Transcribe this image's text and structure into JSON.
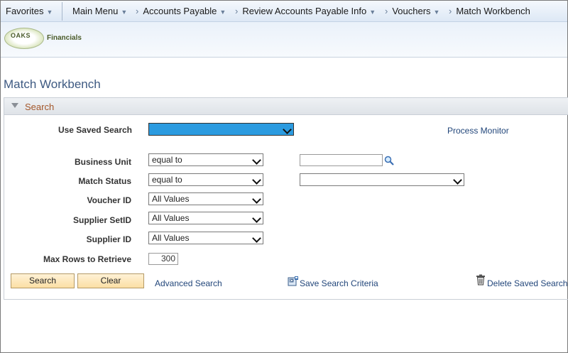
{
  "nav": {
    "favorites": "Favorites",
    "crumbs": [
      "Main Menu",
      "Accounts Payable",
      "Review Accounts Payable Info",
      "Vouchers",
      "Match Workbench"
    ]
  },
  "branding": {
    "logo_text": "OAKS",
    "suffix": "Financials"
  },
  "page": {
    "title": "Match Workbench"
  },
  "search": {
    "header": "Search",
    "saved_search_label": "Use Saved Search",
    "process_monitor": "Process Monitor",
    "fields": {
      "business_unit": {
        "label": "Business Unit",
        "operator": "equal to",
        "value": ""
      },
      "match_status": {
        "label": "Match Status",
        "operator": "equal to",
        "value": ""
      },
      "voucher_id": {
        "label": "Voucher ID",
        "operator": "All Values"
      },
      "supplier_setid": {
        "label": "Supplier SetID",
        "operator": "All Values"
      },
      "supplier_id": {
        "label": "Supplier ID",
        "operator": "All Values"
      },
      "max_rows": {
        "label": "Max Rows to Retrieve",
        "value": "300"
      }
    },
    "buttons": {
      "search": "Search",
      "clear": "Clear"
    },
    "links": {
      "advanced": "Advanced Search",
      "save_criteria": "Save Search Criteria",
      "delete_saved": "Delete Saved Search"
    }
  },
  "colors": {
    "highlight": "#2b9be0",
    "link": "#22467a",
    "title": "#3e5a82",
    "section": "#a4572a"
  }
}
